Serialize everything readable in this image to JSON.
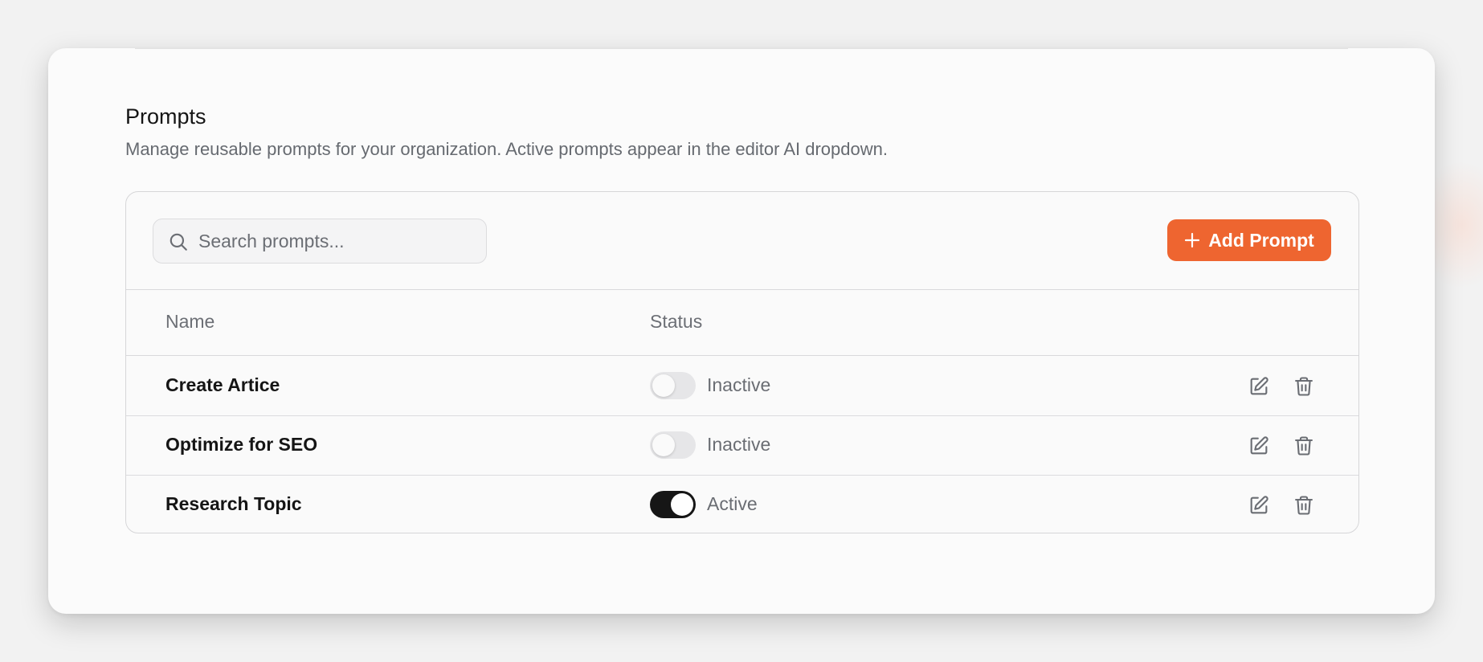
{
  "header": {
    "title": "Prompts",
    "subtitle": "Manage reusable prompts for your organization. Active prompts appear in the editor AI dropdown."
  },
  "search": {
    "placeholder": "Search prompts...",
    "value": ""
  },
  "add_button": {
    "label": "Add Prompt",
    "icon": "plus-icon"
  },
  "table": {
    "columns": [
      "Name",
      "Status"
    ],
    "rows": [
      {
        "name": "Create Artice",
        "active": false,
        "status": "Inactive"
      },
      {
        "name": "Optimize for SEO",
        "active": false,
        "status": "Inactive"
      },
      {
        "name": "Research Topic",
        "active": true,
        "status": "Active"
      }
    ]
  },
  "colors": {
    "accent": "#ee6530",
    "toggle_on": "#161616",
    "toggle_off": "#e6e6e8",
    "muted_text": "#6a6d73"
  },
  "icons": [
    "search-icon",
    "plus-icon",
    "edit-icon",
    "trash-icon"
  ]
}
